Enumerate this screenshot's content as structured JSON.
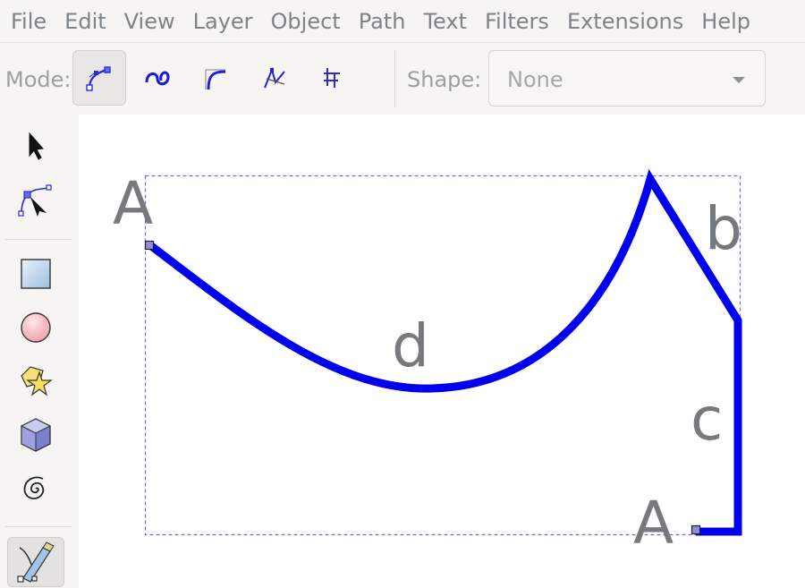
{
  "menubar": {
    "items": [
      "File",
      "Edit",
      "View",
      "Layer",
      "Object",
      "Path",
      "Text",
      "Filters",
      "Extensions",
      "Help"
    ]
  },
  "toolbar": {
    "mode_label": "Mode:",
    "modes": [
      "regular-bezier",
      "spiro-path",
      "bspline-path",
      "zigzag",
      "paraxial"
    ],
    "active_mode": "regular-bezier",
    "shape_label": "Shape:",
    "shape_value": "None"
  },
  "toolbox": {
    "tools": [
      "selector-tool",
      "node-tool",
      "rectangle-tool",
      "ellipse-tool",
      "star-tool",
      "3d-box-tool",
      "spiral-tool",
      "pen-tool"
    ],
    "active_tool": "pen-tool"
  },
  "canvas": {
    "labels": {
      "start_a": "A",
      "end_a": "A",
      "b": "b",
      "c": "c",
      "d": "d"
    },
    "path_color": "#0000ee",
    "bbox_color": "#6b6bdd"
  }
}
